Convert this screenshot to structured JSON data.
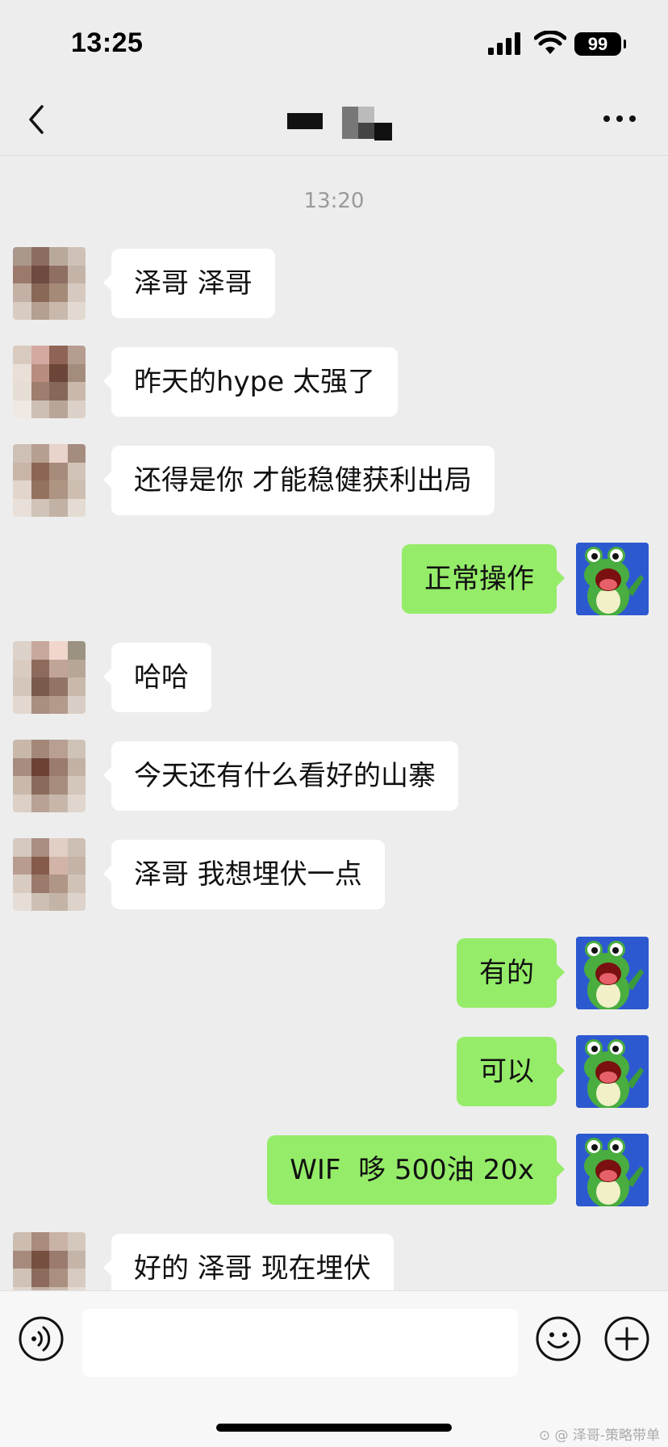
{
  "status_bar": {
    "time": "13:25",
    "battery": "99"
  },
  "nav": {
    "back_icon": "chevron-left-icon",
    "more_icon": "ellipsis-icon"
  },
  "chat": {
    "timestamp": "13:20",
    "messages": [
      {
        "side": "left",
        "text": "泽哥 泽哥"
      },
      {
        "side": "left",
        "text": "昨天的hype 太强了"
      },
      {
        "side": "left",
        "text": "还得是你 才能稳健获利出局"
      },
      {
        "side": "right",
        "text": "正常操作"
      },
      {
        "side": "left",
        "text": "哈哈"
      },
      {
        "side": "left",
        "text": "今天还有什么看好的山寨"
      },
      {
        "side": "left",
        "text": "泽哥 我想埋伏一点"
      },
      {
        "side": "right",
        "text": "有的"
      },
      {
        "side": "right",
        "text": "可以"
      },
      {
        "side": "right",
        "text": "WIF  哆 500油 20x"
      },
      {
        "side": "left",
        "text": "好的 泽哥 现在埋伏"
      }
    ]
  },
  "input_bar": {
    "voice_icon": "voice-icon",
    "emoji_icon": "emoji-icon",
    "plus_icon": "plus-icon",
    "placeholder": ""
  },
  "watermark": "⊙ @ 泽哥-策略带单",
  "colors": {
    "background": "#ededed",
    "sent_bubble": "#95ec69",
    "received_bubble": "#ffffff"
  }
}
